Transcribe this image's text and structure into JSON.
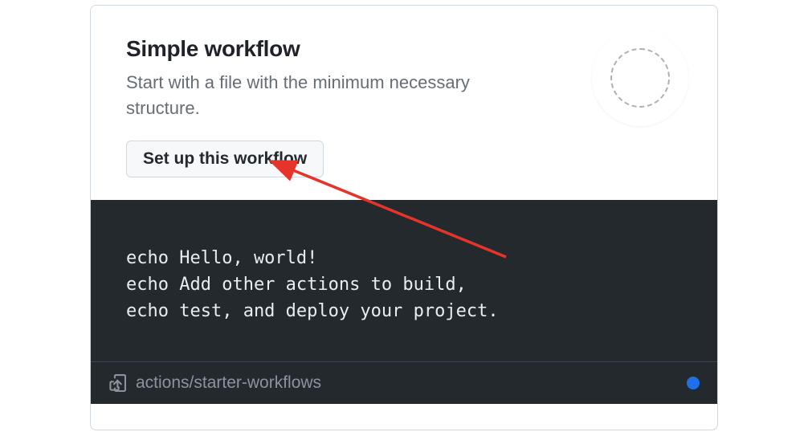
{
  "workflow": {
    "title": "Simple workflow",
    "description": "Start with a file with the minimum necessary structure.",
    "setup_button_label": "Set up this workflow"
  },
  "code": {
    "content": "echo Hello, world!\necho Add other actions to build,\necho test, and deploy your project."
  },
  "footer": {
    "repo_label": "actions/starter-workflows"
  }
}
